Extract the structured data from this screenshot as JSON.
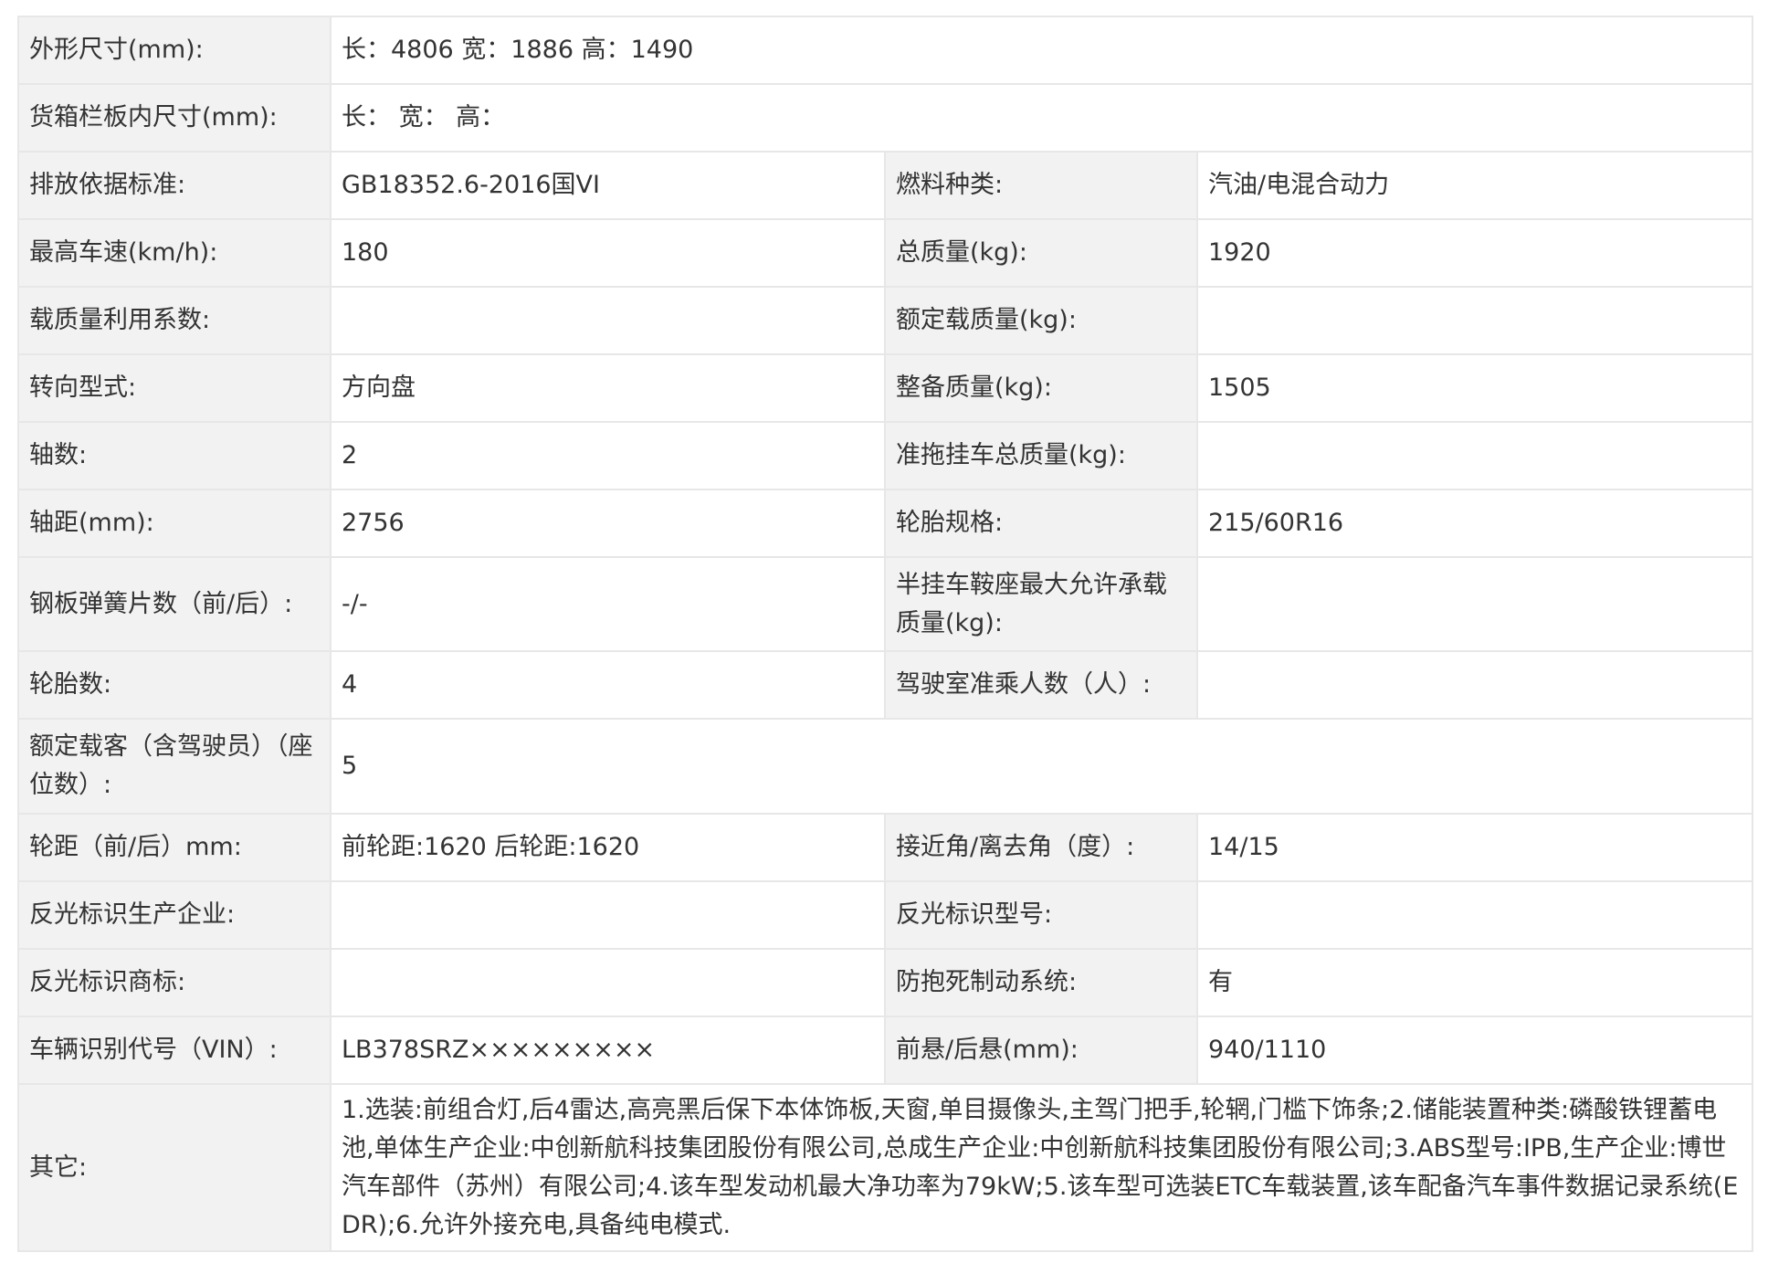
{
  "rows": [
    {
      "label": "外形尺寸(mm):",
      "value": "长：4806 宽：1886 高：1490"
    },
    {
      "label": "货箱栏板内尺寸(mm):",
      "value": "长：   宽：   高："
    },
    {
      "label": "排放依据标准:",
      "value": "GB18352.6-2016国VI",
      "label2": "燃料种类:",
      "value2": "汽油/电混合动力"
    },
    {
      "label": "最高车速(km/h):",
      "value": "180",
      "label2": "总质量(kg):",
      "value2": "1920"
    },
    {
      "label": "载质量利用系数:",
      "value": "",
      "label2": "额定载质量(kg):",
      "value2": ""
    },
    {
      "label": "转向型式:",
      "value": "方向盘",
      "label2": "整备质量(kg):",
      "value2": "1505"
    },
    {
      "label": "轴数:",
      "value": "2",
      "label2": "准拖挂车总质量(kg):",
      "value2": ""
    },
    {
      "label": "轴距(mm):",
      "value": "2756",
      "label2": "轮胎规格:",
      "value2": "215/60R16"
    },
    {
      "label": "钢板弹簧片数（前/后）:",
      "value": "-/-",
      "label2": "半挂车鞍座最大允许承载质量(kg):",
      "value2": ""
    },
    {
      "label": "轮胎数:",
      "value": "4",
      "label2": "驾驶室准乘人数（人）:",
      "value2": ""
    },
    {
      "label": "额定载客（含驾驶员）（座位数）:",
      "value": "5"
    },
    {
      "label": "轮距（前/后）mm:",
      "value": "前轮距:1620 后轮距:1620",
      "label2": "接近角/离去角（度）:",
      "value2": "14/15"
    },
    {
      "label": "反光标识生产企业:",
      "value": "",
      "label2": "反光标识型号:",
      "value2": ""
    },
    {
      "label": "反光标识商标:",
      "value": "",
      "label2": "防抱死制动系统:",
      "value2": "有"
    },
    {
      "label": "车辆识别代号（VIN）:",
      "value": "LB378SRZ×××××××××",
      "label2": "前悬/后悬(mm):",
      "value2": "940/1110"
    },
    {
      "label": "其它:",
      "value": "1.选装:前组合灯,后4雷达,高亮黑后保下本体饰板,天窗,单目摄像头,主驾门把手,轮辋,门槛下饰条;2.储能装置种类:磷酸铁锂蓄电池,单体生产企业:中创新航科技集团股份有限公司,总成生产企业:中创新航科技集团股份有限公司;3.ABS型号:IPB,生产企业:博世汽车部件（苏州）有限公司;4.该车型发动机最大净功率为79kW;5.该车型可选装ETC车载装置,该车配备汽车事件数据记录系统(EDR);6.允许外接充电,具备纯电模式."
    }
  ]
}
